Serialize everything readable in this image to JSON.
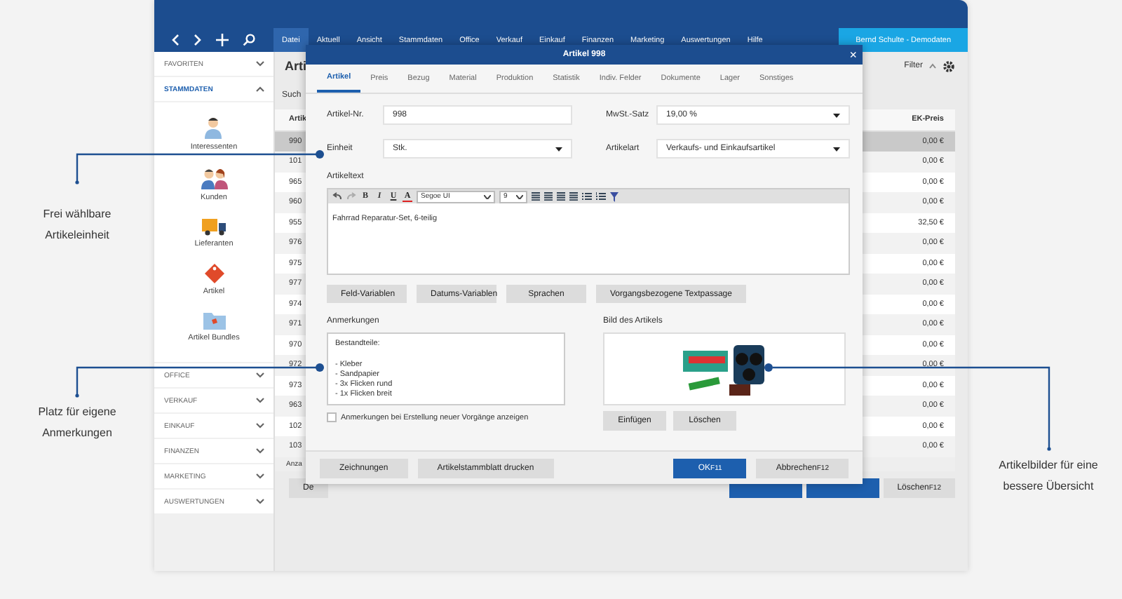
{
  "menu": [
    {
      "label": "Datei",
      "selected": true
    },
    {
      "label": "Aktuell",
      "selected": false
    },
    {
      "label": "Ansicht",
      "selected": false
    },
    {
      "label": "Stammdaten",
      "selected": false
    },
    {
      "label": "Office",
      "selected": false
    },
    {
      "label": "Verkauf",
      "selected": false
    },
    {
      "label": "Einkauf",
      "selected": false
    },
    {
      "label": "Finanzen",
      "selected": false
    },
    {
      "label": "Marketing",
      "selected": false
    },
    {
      "label": "Auswertungen",
      "selected": false
    },
    {
      "label": "Hilfe",
      "selected": false
    }
  ],
  "user_badge": "Bernd Schulte - Demodaten",
  "sidebar": [
    {
      "label": "FAVORITEN",
      "expanded": false
    },
    {
      "label": "STAMMDATEN",
      "expanded": true,
      "items": [
        {
          "label": "Interessenten",
          "kind": "person"
        },
        {
          "label": "Kunden",
          "kind": "people"
        },
        {
          "label": "Lieferanten",
          "kind": "truck"
        },
        {
          "label": "Artikel",
          "kind": "tag"
        },
        {
          "label": "Artikel Bundles",
          "kind": "bundle"
        }
      ]
    },
    {
      "label": "OFFICE",
      "expanded": false
    },
    {
      "label": "VERKAUF",
      "expanded": false
    },
    {
      "label": "EINKAUF",
      "expanded": false
    },
    {
      "label": "FINANZEN",
      "expanded": false
    },
    {
      "label": "MARKETING",
      "expanded": false
    },
    {
      "label": "AUSWERTUNGEN",
      "expanded": false
    }
  ],
  "list": {
    "title": "Arti",
    "search_label": "Such",
    "filter_label": "Filter",
    "columns": [
      "Artik",
      "EK-Preis"
    ],
    "rows": [
      {
        "number": "990",
        "ek_preis": "0,00 €",
        "selected": true
      },
      {
        "number": "101",
        "ek_preis": "0,00 €",
        "selected": false
      },
      {
        "number": "965",
        "ek_preis": "0,00 €",
        "selected": false
      },
      {
        "number": "960",
        "ek_preis": "0,00 €",
        "selected": false
      },
      {
        "number": "955",
        "ek_preis": "32,50 €",
        "selected": false
      },
      {
        "number": "976",
        "ek_preis": "0,00 €",
        "selected": false
      },
      {
        "number": "975",
        "ek_preis": "0,00 €",
        "selected": false
      },
      {
        "number": "977",
        "ek_preis": "0,00 €",
        "selected": false
      },
      {
        "number": "974",
        "ek_preis": "0,00 €",
        "selected": false
      },
      {
        "number": "971",
        "ek_preis": "0,00 €",
        "selected": false
      },
      {
        "number": "970",
        "ek_preis": "0,00 €",
        "selected": false
      },
      {
        "number": "972",
        "ek_preis": "0,00 €",
        "selected": false
      },
      {
        "number": "973",
        "ek_preis": "0,00 €",
        "selected": false
      },
      {
        "number": "963",
        "ek_preis": "0,00 €",
        "selected": false
      },
      {
        "number": "102",
        "ek_preis": "0,00 €",
        "selected": false
      },
      {
        "number": "103",
        "ek_preis": "0,00 €",
        "selected": false
      }
    ],
    "footer": "Anza",
    "buttons": [
      {
        "label": "De",
        "kind": "plain"
      },
      {
        "kind": "primary"
      },
      {
        "kind": "primary"
      },
      {
        "label": "Löschen",
        "shortcut": "F12",
        "kind": "plain"
      }
    ]
  },
  "dialog": {
    "title": "Artikel 998",
    "close": "×",
    "tabs": [
      {
        "label": "Artikel",
        "selected": true
      },
      {
        "label": "Preis",
        "selected": false
      },
      {
        "label": "Bezug",
        "selected": false
      },
      {
        "label": "Material",
        "selected": false
      },
      {
        "label": "Produktion",
        "selected": false
      },
      {
        "label": "Statistik",
        "selected": false
      },
      {
        "label": "Indiv. Felder",
        "selected": false
      },
      {
        "label": "Dokumente",
        "selected": false
      },
      {
        "label": "Lager",
        "selected": false
      },
      {
        "label": "Sonstiges",
        "selected": false
      }
    ],
    "fields": [
      {
        "label": "Artikel-Nr.",
        "value": "998",
        "kind": "input"
      },
      {
        "label": "MwSt.-Satz",
        "value": "19,00 %",
        "kind": "select"
      },
      {
        "label": "Einheit",
        "value": "Stk.",
        "kind": "select"
      },
      {
        "label": "Artikelart",
        "value": "Verkaufs- und Einkaufsartikel",
        "kind": "select"
      }
    ],
    "text_label": "Artikeltext",
    "toolbar": {
      "format_buttons": [
        "B",
        "I",
        "U"
      ],
      "color_button": "A",
      "font": "Segoe UI",
      "size": "9"
    },
    "text_value": "Fahrrad Reparatur-Set, 6-teilig",
    "text_buttons": [
      "Feld-Variablen",
      "Datums-Variablen",
      "Sprachen",
      "Vorgangsbezogene Textpassage"
    ],
    "notes": {
      "label": "Anmerkungen",
      "value": "Bestandteile:\n\n- Kleber\n- Sandpapier\n- 3x Flicken rund\n- 1x Flicken breit"
    },
    "image": {
      "label": "Bild des Artikels",
      "buttons": [
        "Einfügen",
        "Löschen"
      ]
    },
    "show_notes": {
      "label": "Anmerkungen bei Erstellung neuer Vorgänge anzeigen",
      "checked": false
    },
    "footer_buttons": [
      {
        "label": "Zeichnungen",
        "kind": "plain"
      },
      {
        "label": "Artikelstammblatt drucken",
        "kind": "plain"
      },
      {
        "label": "OK",
        "shortcut": "F11",
        "kind": "primary"
      },
      {
        "label": "Abbrechen",
        "shortcut": "F12",
        "kind": "plain"
      }
    ]
  },
  "callouts": [
    {
      "text": "Frei wählbare Artikeleinheit"
    },
    {
      "text": "Platz für eigene Anmerkungen"
    },
    {
      "text": "Artikelbilder für eine bessere Übersicht"
    }
  ]
}
